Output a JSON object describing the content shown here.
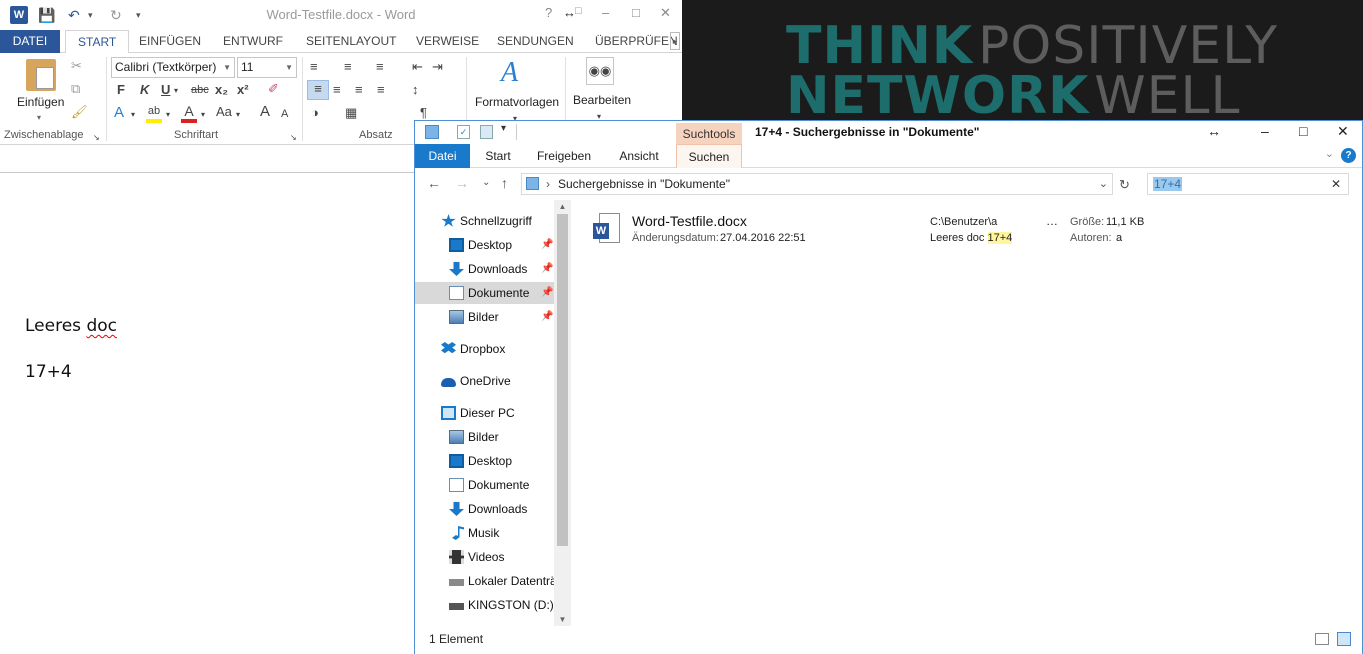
{
  "word": {
    "title": "Word-Testfile.docx - Word",
    "tabs": [
      "DATEI",
      "START",
      "EINFÜGEN",
      "ENTWURF",
      "SEITENLAYOUT",
      "VERWEISE",
      "SENDUNGEN",
      "ÜBERPRÜFEN"
    ],
    "ribbon": {
      "paste_label": "Einfügen",
      "font_name": "Calibri (Textkörper)",
      "font_size": "11",
      "format_label": "Formatvorlagen",
      "edit_label": "Bearbeiten",
      "groups": [
        "Zwischenablage",
        "Schriftart",
        "Absatz"
      ],
      "bold": "F",
      "italic": "K",
      "underline": "U",
      "strike": "abc",
      "subscript": "x₂",
      "superscript": "x²",
      "case": "Aa",
      "grow": "A",
      "shrink": "A"
    },
    "doc_lines": [
      "Leeres doc",
      "17+4"
    ]
  },
  "wallpaper": {
    "line1_bold": "THINK",
    "line1_light": "POSITIVELY",
    "line2_bold": "NETWORK",
    "line2_light": "WELL"
  },
  "explorer": {
    "title": "17+4 - Suchergebnisse in \"Dokumente\"",
    "context_tab": "Suchtools",
    "tabs": [
      "Datei",
      "Start",
      "Freigeben",
      "Ansicht",
      "Suchen"
    ],
    "address": "Suchergebnisse in \"Dokumente\"",
    "search_value": "17+4",
    "nav": [
      {
        "label": "Schnellzugriff",
        "icon": "star-icon",
        "indent": 0,
        "pin": false
      },
      {
        "label": "Desktop",
        "icon": "desktop-icon",
        "indent": 1,
        "pin": true
      },
      {
        "label": "Downloads",
        "icon": "download-icon",
        "indent": 1,
        "pin": true
      },
      {
        "label": "Dokumente",
        "icon": "document-icon",
        "indent": 1,
        "pin": true,
        "selected": true
      },
      {
        "label": "Bilder",
        "icon": "pictures-icon",
        "indent": 1,
        "pin": true
      },
      {
        "label": "Dropbox",
        "icon": "dropbox-icon",
        "indent": 0,
        "pin": false
      },
      {
        "label": "OneDrive",
        "icon": "cloud-icon",
        "indent": 0,
        "pin": false
      },
      {
        "label": "Dieser PC",
        "icon": "pc-icon",
        "indent": 0,
        "pin": false
      },
      {
        "label": "Bilder",
        "icon": "pictures-icon",
        "indent": 1,
        "pin": false
      },
      {
        "label": "Desktop",
        "icon": "desktop-icon",
        "indent": 1,
        "pin": false
      },
      {
        "label": "Dokumente",
        "icon": "document-icon",
        "indent": 1,
        "pin": false
      },
      {
        "label": "Downloads",
        "icon": "download-icon",
        "indent": 1,
        "pin": false
      },
      {
        "label": "Musik",
        "icon": "music-icon",
        "indent": 1,
        "pin": false
      },
      {
        "label": "Videos",
        "icon": "video-icon",
        "indent": 1,
        "pin": false
      },
      {
        "label": "Lokaler Datenträge",
        "icon": "drive-icon",
        "indent": 1,
        "pin": false
      },
      {
        "label": "KINGSTON (D:)",
        "icon": "usb-drive-icon",
        "indent": 1,
        "pin": false
      }
    ],
    "result": {
      "name": "Word-Testfile.docx",
      "date_label": "Änderungsdatum:",
      "date": "27.04.2016 22:51",
      "path": "C:\\Benutzer\\a",
      "snippet_prefix": "Leeres doc",
      "snippet_hit": "17+4",
      "ellipsis": "…",
      "size_label": "Größe:",
      "size": "11,1 KB",
      "author_label": "Autoren:",
      "author": "a"
    },
    "status": "1 Element"
  },
  "colors": {
    "word_blue": "#2b579a",
    "explorer_blue": "#1979ca",
    "context_orange": "#f6d3be",
    "highlight": "#fff59d",
    "wallpaper_teal": "#1c6d6b"
  }
}
